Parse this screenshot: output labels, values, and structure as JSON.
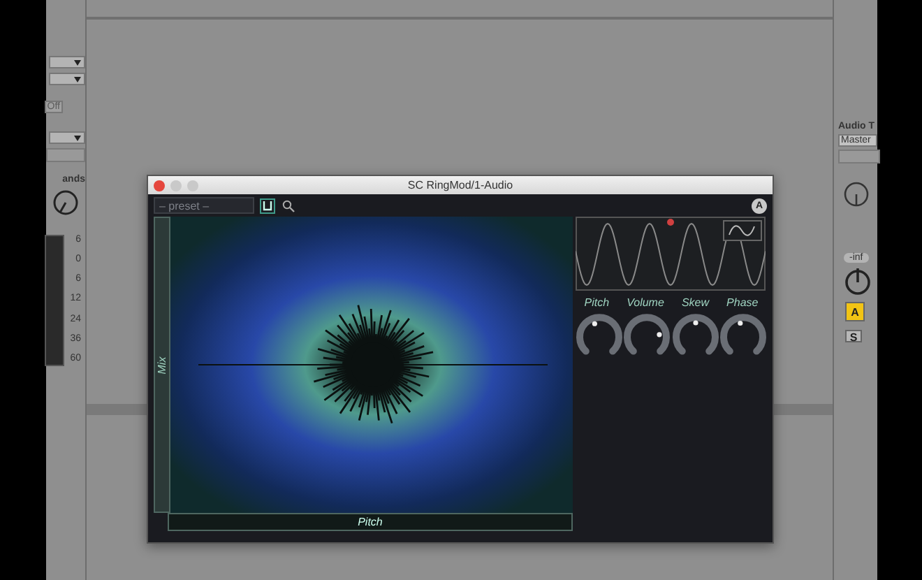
{
  "left_strip": {
    "toggle": "Off",
    "section_label": "ands",
    "meter_scale": [
      "6",
      "0",
      "6",
      "12",
      "24",
      "36",
      "60"
    ]
  },
  "right_strip": {
    "header": "Audio T",
    "output": "Master",
    "volume": "-inf",
    "buttons": [
      {
        "label": "A",
        "selected": true
      },
      {
        "label": "S",
        "selected": false
      }
    ]
  },
  "plugin": {
    "title": "SC RingMod/1-Audio",
    "preset": {
      "placeholder": "– preset –"
    },
    "auto_button": "A",
    "y_axis_label": "Mix",
    "x_axis_label": "Pitch",
    "knobs": [
      {
        "label": "Pitch",
        "level": 0.42
      },
      {
        "label": "Volume",
        "level": 0.82
      },
      {
        "label": "Skew",
        "level": 0.5
      },
      {
        "label": "Phase",
        "level": 0.45
      }
    ]
  }
}
